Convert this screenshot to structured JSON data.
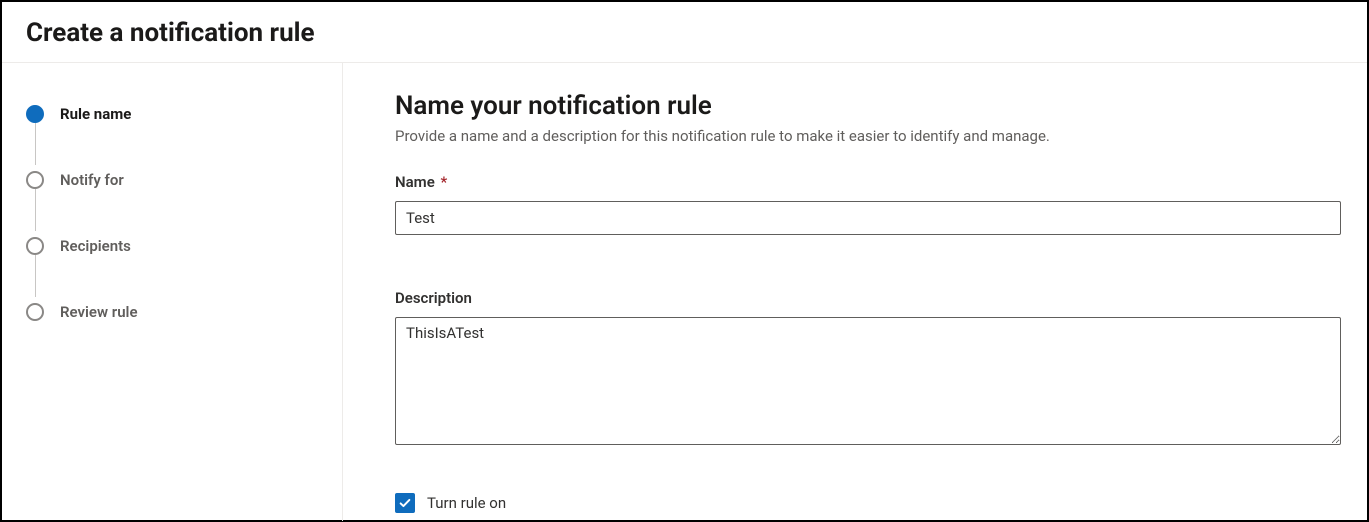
{
  "header": {
    "title": "Create a notification rule"
  },
  "sidebar": {
    "steps": [
      {
        "label": "Rule name",
        "active": true
      },
      {
        "label": "Notify for",
        "active": false
      },
      {
        "label": "Recipients",
        "active": false
      },
      {
        "label": "Review rule",
        "active": false
      }
    ]
  },
  "main": {
    "title": "Name your notification rule",
    "subtitle": "Provide a name and a description for this notification rule to make it easier to identify and manage.",
    "name_label": "Name",
    "name_required_mark": "*",
    "name_value": "Test",
    "description_label": "Description",
    "description_value": "ThisIsATest",
    "toggle_label": "Turn rule on",
    "toggle_checked": true
  },
  "colors": {
    "accent": "#0f6cbd",
    "border": "#605e5c",
    "text_secondary": "#605e5c",
    "required": "#a4262c"
  }
}
